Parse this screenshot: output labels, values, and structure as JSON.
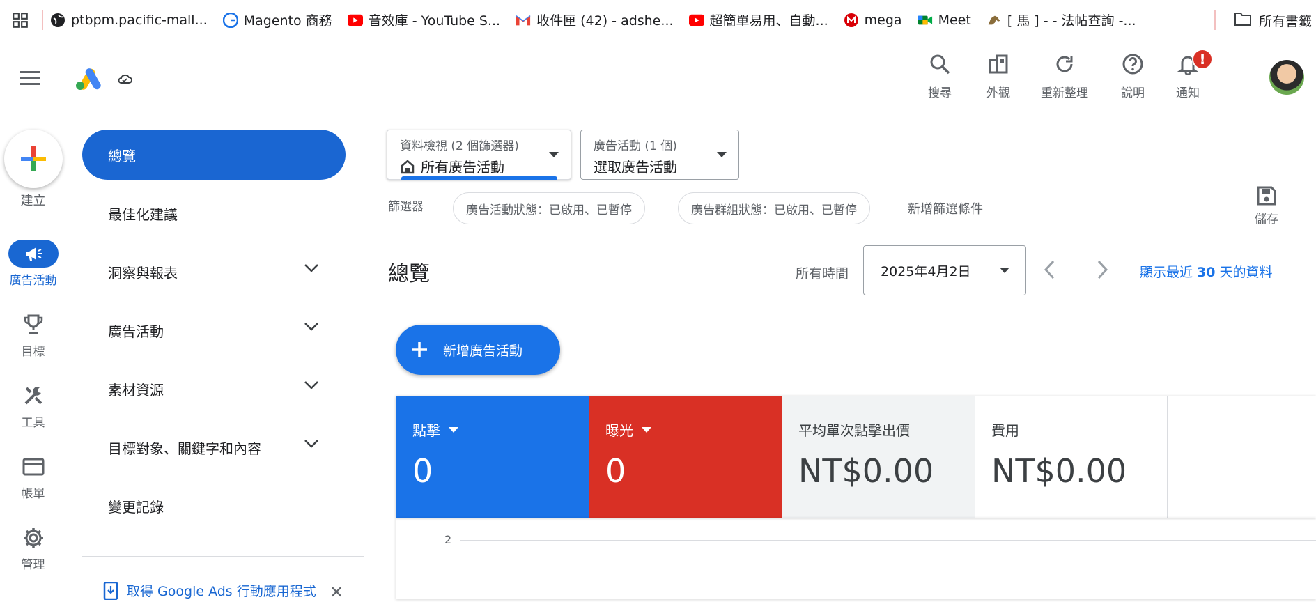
{
  "bookmarks": [
    {
      "label": "ptbpm.pacific-mall...",
      "icon": "globe-icon"
    },
    {
      "label": "Magento 商務",
      "icon": "g-icon"
    },
    {
      "label": "音效庫 - YouTube S...",
      "icon": "youtube-icon"
    },
    {
      "label": "收件匣 (42) - adshe...",
      "icon": "gmail-icon"
    },
    {
      "label": "超簡單易用、自動...",
      "icon": "youtube-icon"
    },
    {
      "label": "mega",
      "icon": "mega-icon"
    },
    {
      "label": "Meet",
      "icon": "meet-icon"
    },
    {
      "label": "[ 馬 ] - - 法帖查詢 -...",
      "icon": "horse-icon"
    }
  ],
  "bookmarks_folder": "所有書籤",
  "header": {
    "search": "搜尋",
    "appearance": "外觀",
    "refresh": "重新整理",
    "help": "說明",
    "notifications": "通知",
    "notification_badge": "!"
  },
  "rail": {
    "create": "建立",
    "campaigns": "廣告活動",
    "goals": "目標",
    "tools": "工具",
    "billing": "帳單",
    "admin": "管理"
  },
  "nav": {
    "items": [
      {
        "label": "總覽",
        "active": true
      },
      {
        "label": "最佳化建議"
      },
      {
        "label": "洞察與報表",
        "expandable": true
      },
      {
        "label": "廣告活動",
        "expandable": true
      },
      {
        "label": "素材資源",
        "expandable": true
      },
      {
        "label": "目標對象、關鍵字和內容",
        "expandable": true
      },
      {
        "label": "變更記錄"
      }
    ],
    "promo": "取得 Google Ads 行動應用程式"
  },
  "filters": {
    "view_title": "資料檢視 (2 個篩選器)",
    "view_value": "所有廣告活動",
    "campaign_title": "廣告活動 (1 個)",
    "campaign_value": "選取廣告活動",
    "label": "篩選器",
    "chip1": "廣告活動狀態：已啟用、已暫停",
    "chip2": "廣告群組狀態：已啟用、已暫停",
    "add": "新增篩選條件",
    "save": "儲存"
  },
  "overview": {
    "title": "總覽",
    "all_time": "所有時間",
    "date": "2025年4月2日",
    "last30_prefix": "顯示最近 ",
    "last30_num": "30",
    "last30_suffix": " 天的資料",
    "new_campaign": "新增廣告活動"
  },
  "metrics": [
    {
      "label": "點擊",
      "value": "0",
      "color": "#1a73e8"
    },
    {
      "label": "曝光",
      "value": "0",
      "color": "#d93025"
    },
    {
      "label": "平均單次點擊出價",
      "value": "NT$0.00"
    },
    {
      "label": "費用",
      "value": "NT$0.00"
    }
  ],
  "chart": {
    "y_tick": "2"
  }
}
